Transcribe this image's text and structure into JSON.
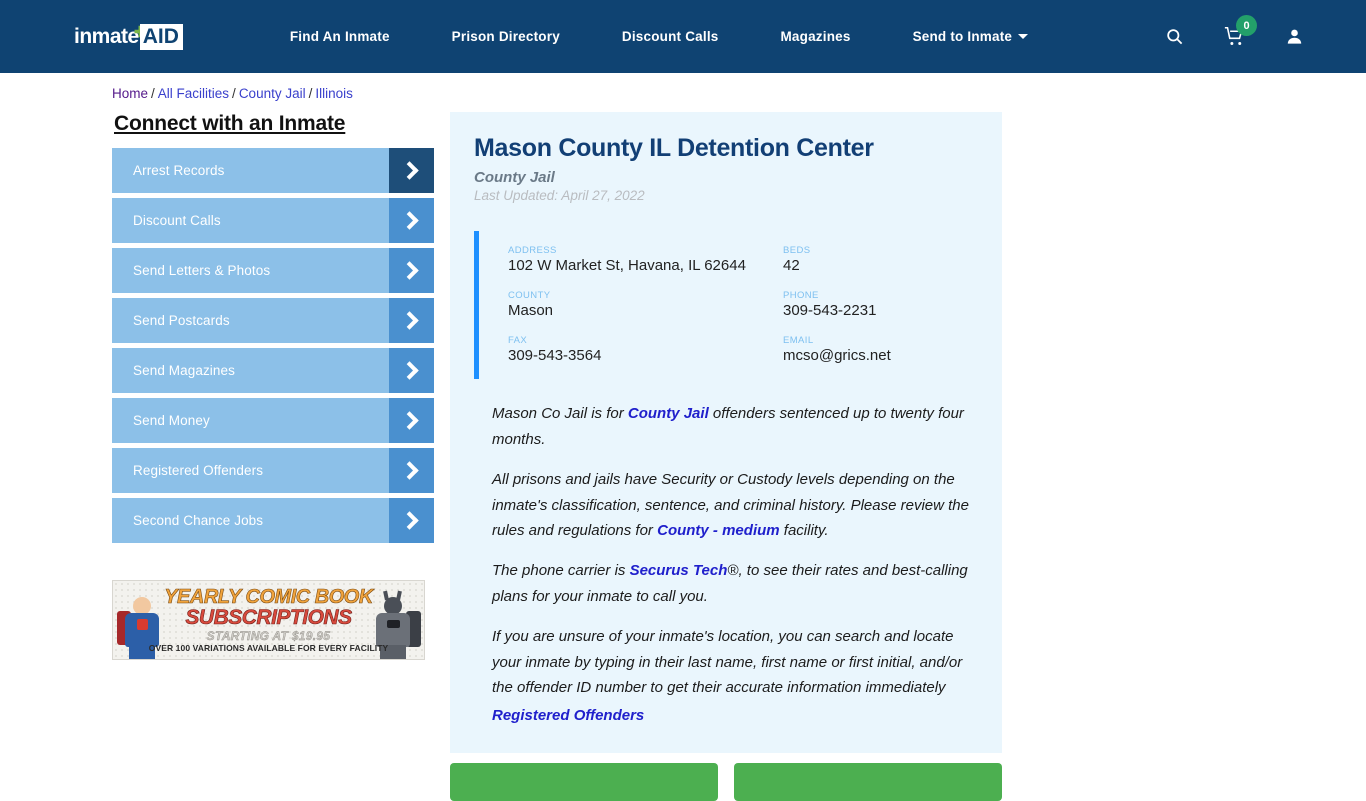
{
  "header": {
    "logo_inmate": "inmate",
    "logo_aid": "AID",
    "nav": [
      {
        "label": "Find An Inmate",
        "caret": false
      },
      {
        "label": "Prison Directory",
        "caret": false
      },
      {
        "label": "Discount Calls",
        "caret": false
      },
      {
        "label": "Magazines",
        "caret": false
      },
      {
        "label": "Send to Inmate",
        "caret": true
      }
    ],
    "cart_count": "0",
    "brand_color": "#0f4372",
    "badge_color": "#23a06a"
  },
  "breadcrumb": {
    "items": [
      "Home",
      "All Facilities",
      "County Jail",
      "Illinois"
    ],
    "separator": "/"
  },
  "sidebar": {
    "title": "Connect with an Inmate",
    "items": [
      {
        "label": "Arrest Records",
        "active": true
      },
      {
        "label": "Discount Calls",
        "active": false
      },
      {
        "label": "Send Letters & Photos",
        "active": false
      },
      {
        "label": "Send Postcards",
        "active": false
      },
      {
        "label": "Send Magazines",
        "active": false
      },
      {
        "label": "Send Money",
        "active": false
      },
      {
        "label": "Registered Offenders",
        "active": false
      },
      {
        "label": "Second Chance Jobs",
        "active": false
      }
    ]
  },
  "ad": {
    "line1": "YEARLY COMIC BOOK",
    "line2": "SUBSCRIPTIONS",
    "line3": "STARTING AT $19.95",
    "line4": "OVER 100 VARIATIONS AVAILABLE FOR EVERY FACILITY"
  },
  "facility": {
    "title": "Mason County IL Detention Center",
    "type": "County Jail",
    "updated": "Last Updated: April 27, 2022",
    "fields": [
      {
        "label": "ADDRESS",
        "value": "102 W Market St, Havana, IL 62644"
      },
      {
        "label": "BEDS",
        "value": "42"
      },
      {
        "label": "COUNTY",
        "value": "Mason"
      },
      {
        "label": "PHONE",
        "value": "309-543-2231"
      },
      {
        "label": "FAX",
        "value": "309-543-3564"
      },
      {
        "label": "EMAIL",
        "value": "mcso@grics.net"
      }
    ]
  },
  "body": {
    "p1_a": "Mason Co Jail is for ",
    "p1_link": "County Jail",
    "p1_b": " offenders sentenced up to twenty four months.",
    "p2_a": "All prisons and jails have Security or Custody levels depending on the inmate's classification, sentence, and criminal history. Please review the rules and regulations for ",
    "p2_link": "County - medium",
    "p2_b": " facility.",
    "p3_a": "The phone carrier is ",
    "p3_link": "Securus Tech",
    "p3_b": "®, to see their rates and best-calling plans for your inmate to call you.",
    "p4": "If you are unsure of your inmate's location, you can search and locate your inmate by typing in their last name, first name or first initial, and/or the offender ID number to get their accurate information immediately",
    "registered_offenders_link": "Registered Offenders"
  },
  "bottom_buttons": [
    {
      "label": ""
    },
    {
      "label": ""
    }
  ]
}
